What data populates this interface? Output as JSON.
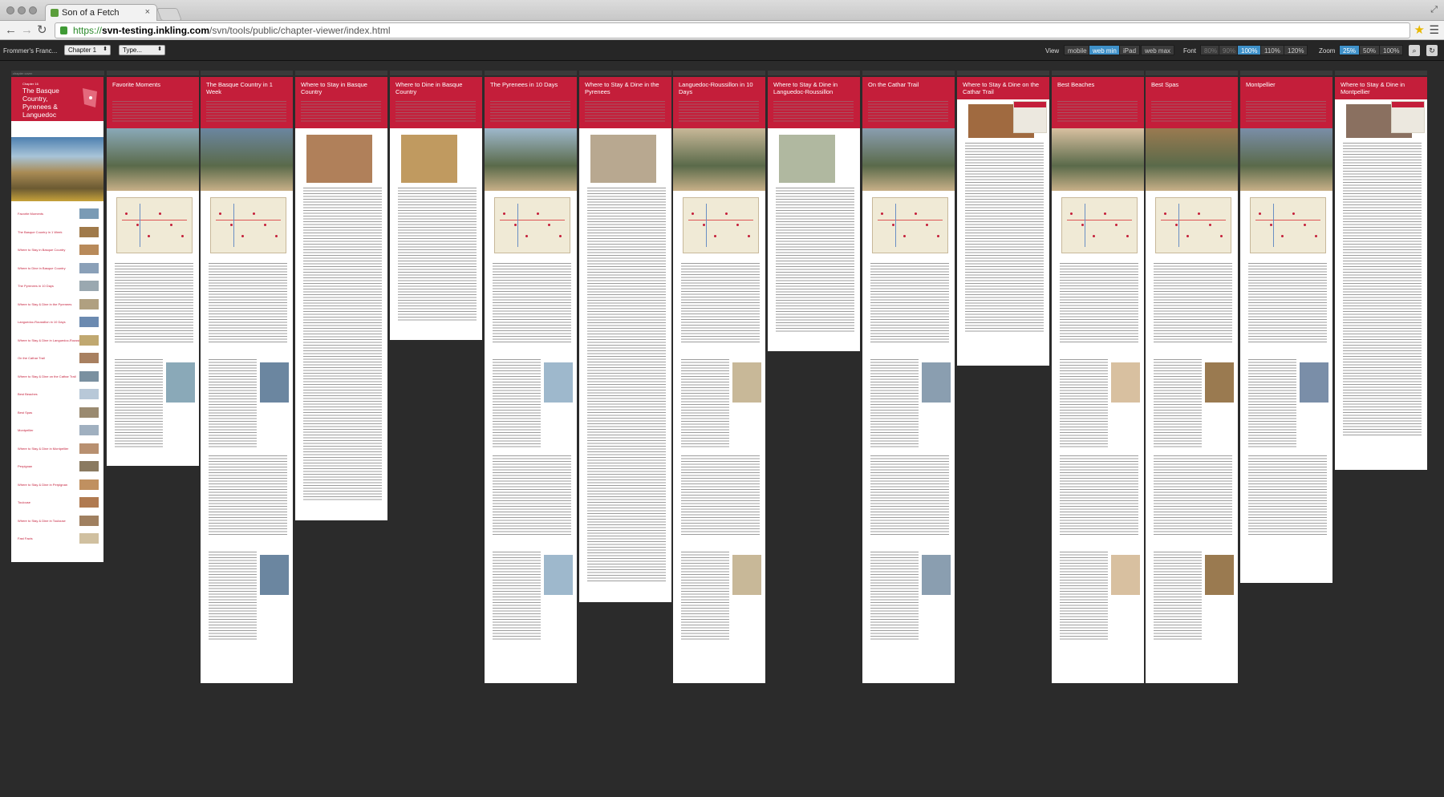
{
  "browser": {
    "tab_title": "Son of a Fetch",
    "tab_close": "×",
    "url_protocol": "https://",
    "url_host": "svn-testing.inkling.com",
    "url_path": "/svn/tools/public/chapter-viewer/index.html"
  },
  "viewer": {
    "book_select": "Frommer's Franc...",
    "chapter_select": "Chapter 1",
    "type_select": "Type...",
    "view_label": "View",
    "view_options": [
      "mobile",
      "web min",
      "iPad",
      "web max"
    ],
    "view_selected": "web min",
    "font_label": "Font",
    "font_options": [
      "80%",
      "90%",
      "100%",
      "110%",
      "120%"
    ],
    "font_selected": "100%",
    "zoom_label": "Zoom",
    "zoom_options": [
      "25%",
      "50%",
      "100%"
    ],
    "zoom_selected": "25%"
  },
  "pages": [
    {
      "title": "The Basque Country, Pyrenees & Languedoc",
      "kicker": "Chapter 16"
    },
    {
      "title": "Favorite Moments"
    },
    {
      "title": "The Basque Country in 1 Week"
    },
    {
      "title": "Where to Stay in Basque Country"
    },
    {
      "title": "Where to Dine in Basque Country"
    },
    {
      "title": "The Pyrenees in 10 Days"
    },
    {
      "title": "Where to Stay & Dine in the Pyrenees"
    },
    {
      "title": "Languedoc-Roussillon in 10 Days"
    },
    {
      "title": "Where to Stay & Dine in Languedoc-Roussillon"
    },
    {
      "title": "On the Cathar Trail"
    },
    {
      "title": "Where to Stay & Dine on the Cathar Trail"
    },
    {
      "title": "Best Beaches"
    },
    {
      "title": "Best Spas"
    },
    {
      "title": "Montpellier"
    },
    {
      "title": "Where to Stay & Dine in Montpellier"
    }
  ],
  "toc_items": [
    "Favorite Moments",
    "The Basque Country in 1 Week",
    "Where to Stay in Basque Country",
    "Where to Dine in Basque Country",
    "The Pyrenees in 10 Days",
    "Where to Stay & Dine in the Pyrenees",
    "Languedoc-Roussillon in 10 Days",
    "Where to Stay & Dine in Languedoc-Roussillon",
    "On the Cathar Trail",
    "Where to Stay & Dine on the Cathar Trail",
    "Best Beaches",
    "Best Spas",
    "Montpellier",
    "Where to Stay & Dine in Montpellier",
    "Perpignan",
    "Where to Stay & Dine in Perpignan",
    "Toulouse",
    "Where to Stay & Dine in Toulouse",
    "Fast Facts"
  ],
  "colors": {
    "accent": "#c41e3a",
    "viewer_bg": "#2b2b2b",
    "selected": "#3e90c8"
  }
}
